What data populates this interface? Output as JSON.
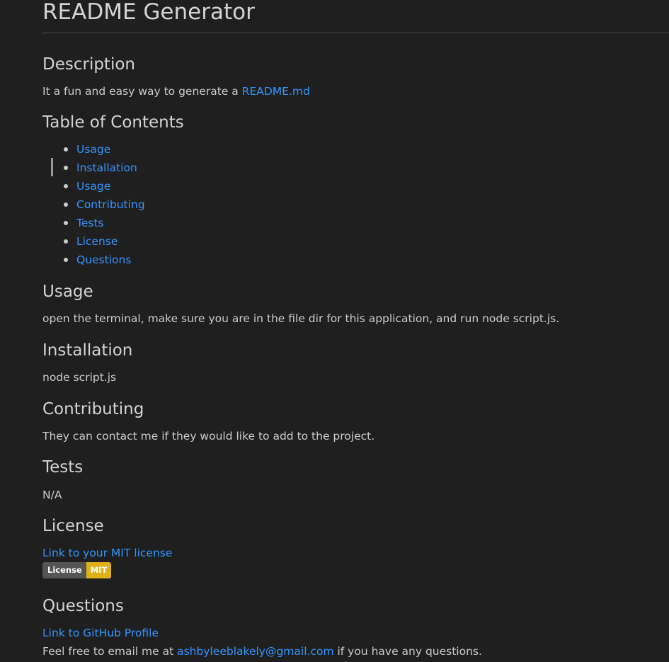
{
  "title": "README Generator",
  "description": {
    "heading": "Description",
    "text": "It a fun and easy way to generate a ",
    "link": "README.md"
  },
  "toc": {
    "heading": "Table of Contents",
    "items": [
      "Usage",
      "Installation",
      "Usage",
      "Contributing",
      "Tests",
      "License",
      "Questions"
    ]
  },
  "usage": {
    "heading": "Usage",
    "text": "open the terminal, make sure you are in the file dir for this application, and run node script.js."
  },
  "installation": {
    "heading": "Installation",
    "text": "node script.js"
  },
  "contributing": {
    "heading": "Contributing",
    "text": "They can contact me if they would like to add to the project."
  },
  "tests": {
    "heading": "Tests",
    "text": "N/A"
  },
  "license": {
    "heading": "License",
    "link": "Link to your MIT license",
    "badge_label": "License",
    "badge_value": "MIT",
    "badge_colors": {
      "label_bg": "#555555",
      "value_bg": "#dfb317"
    }
  },
  "questions": {
    "heading": "Questions",
    "profile_link": "Link to GitHub Profile",
    "email_prefix": "Feel free to email me at ",
    "email": "ashbyleeblakely@gmail.com",
    "email_suffix": " if you have any questions."
  },
  "colors": {
    "background": "#1f1f1f",
    "text": "#cccccc",
    "heading": "#d4d4d4",
    "link": "#3794ff"
  }
}
